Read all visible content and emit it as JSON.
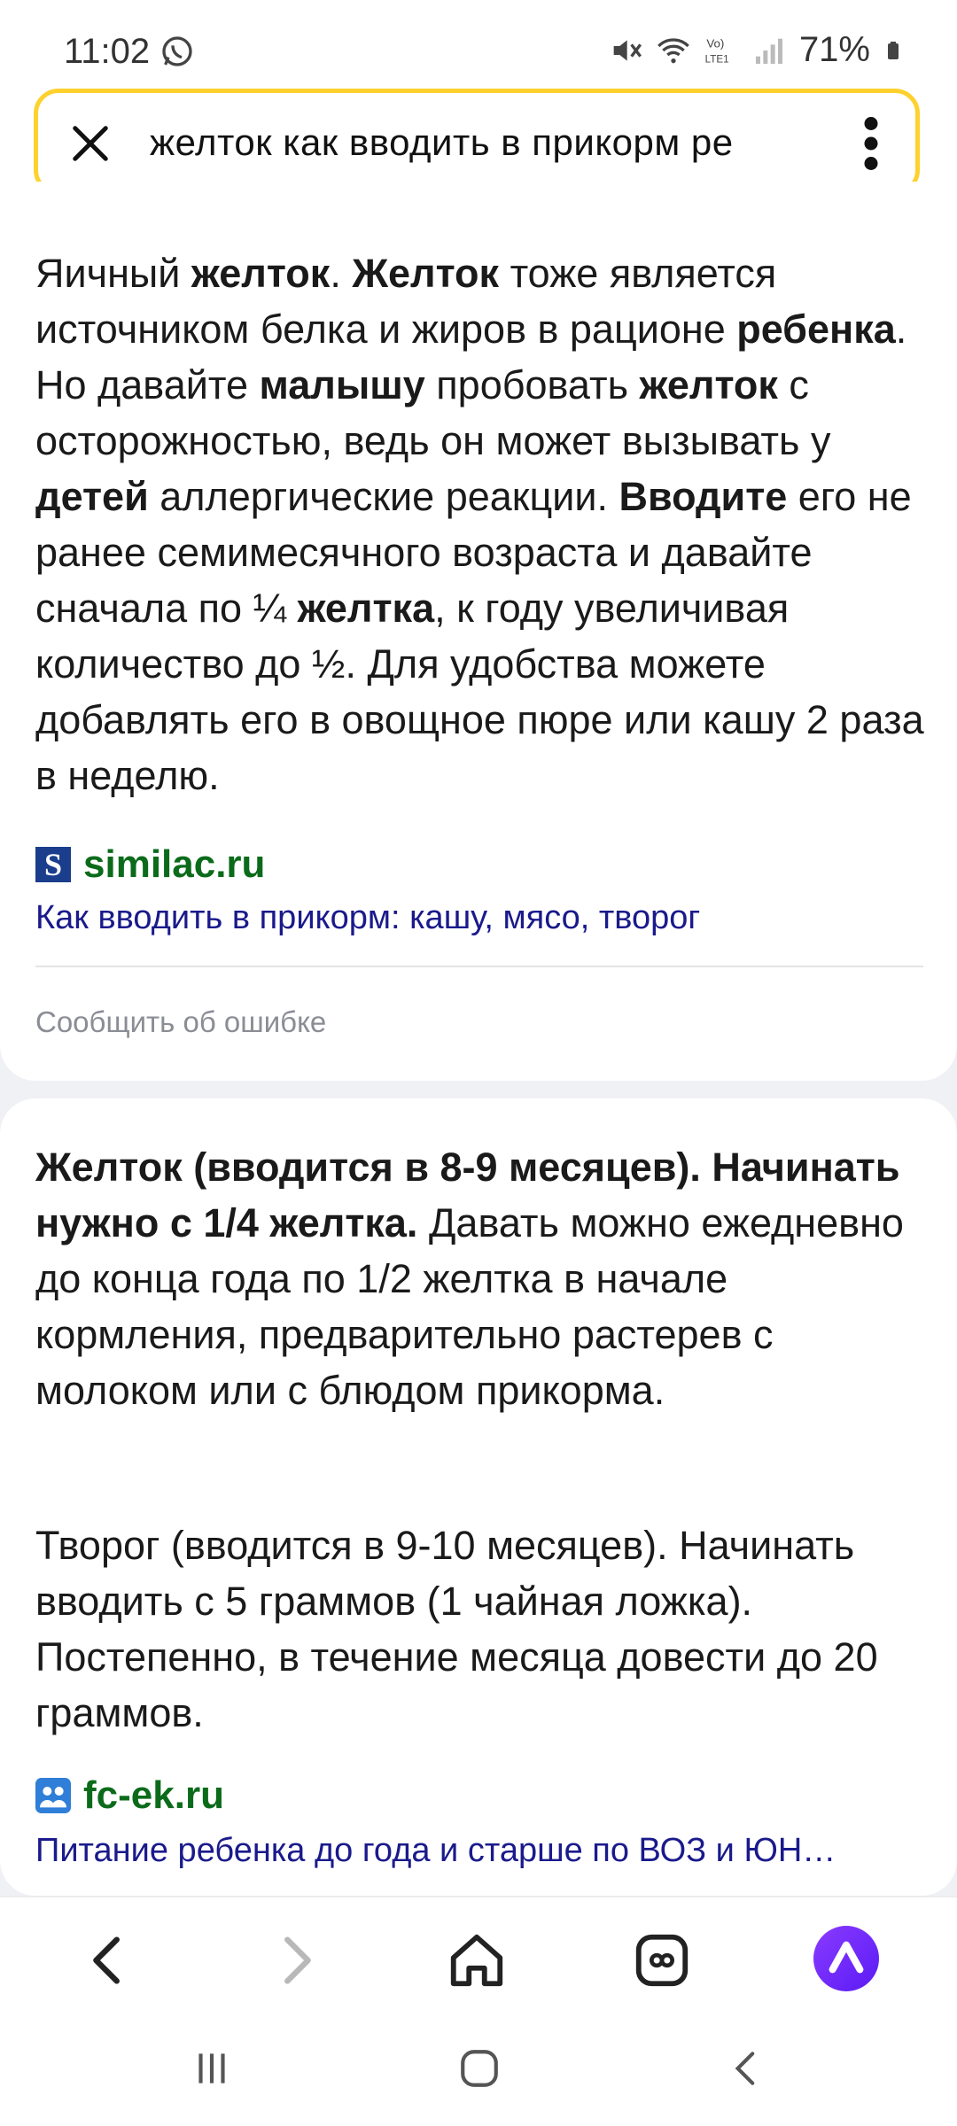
{
  "status": {
    "time": "11:02",
    "battery": "71%"
  },
  "search": {
    "query": "желток как вводить в прикорм ре"
  },
  "results": [
    {
      "source": "similac.ru",
      "link": "Как вводить в прикорм: кашу, мясо, творог",
      "report": "Сообщить об ошибке"
    },
    {
      "source": "fc-ek.ru",
      "link": "Питание ребенка до года и старше по ВОЗ и ЮН…"
    }
  ],
  "icons": [
    "whatsapp-icon",
    "mute-icon",
    "wifi-icon",
    "volte-icon",
    "signal-icon",
    "battery-icon",
    "close-icon",
    "more-vert-icon",
    "back-icon",
    "forward-icon",
    "home-icon",
    "tabs-icon",
    "alice-icon",
    "recents-icon",
    "home-circle-icon",
    "system-back-icon"
  ],
  "colors": {
    "search_border": "#ffd12e",
    "domain": "#0b6b1a",
    "link": "#1a1a8c",
    "alice": "#7a2bff"
  }
}
